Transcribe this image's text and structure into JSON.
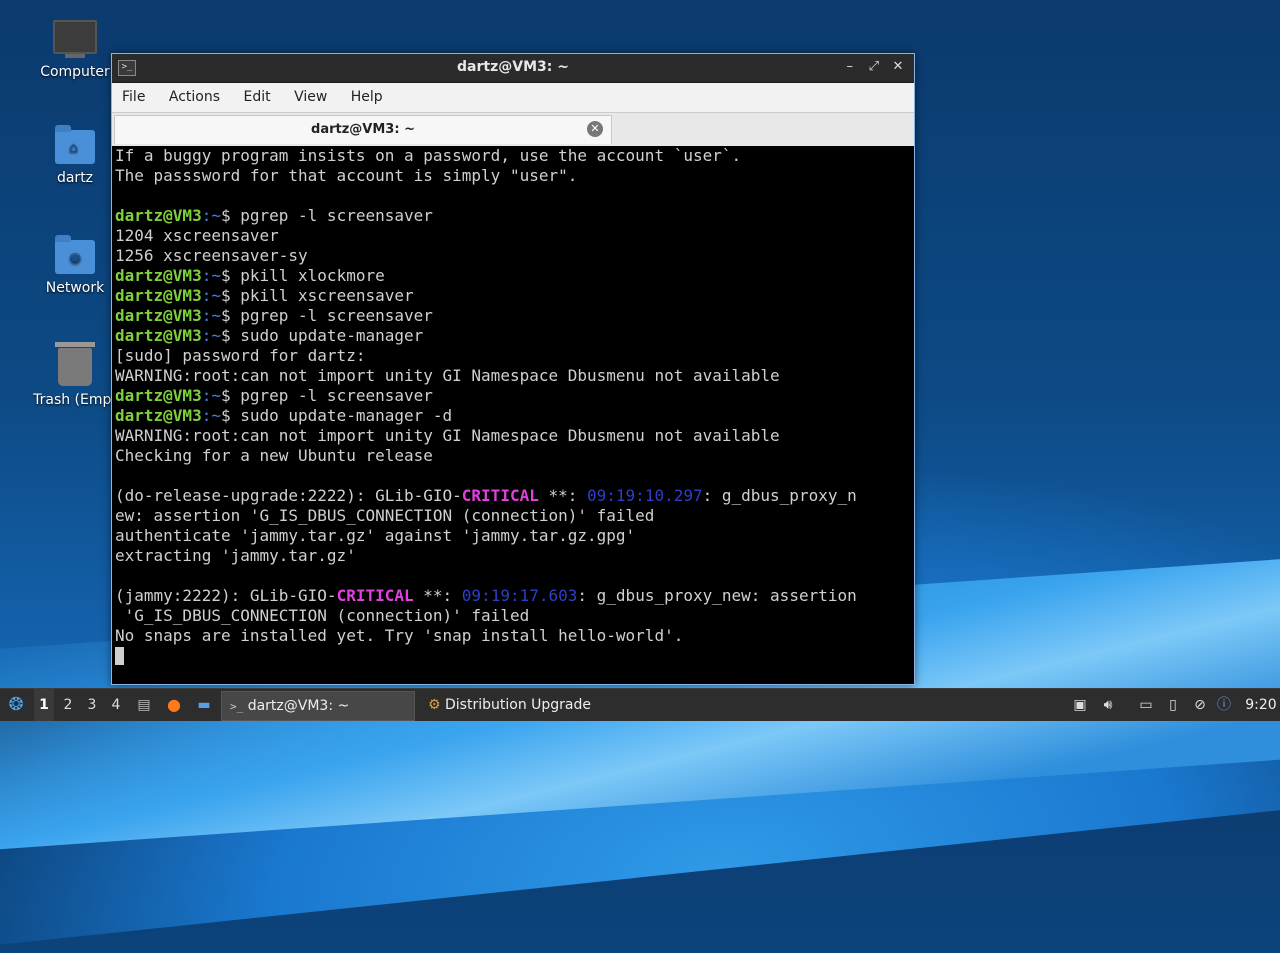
{
  "desktop": {
    "icons": [
      {
        "label": "Computer",
        "icon": "computer-icon"
      },
      {
        "label": "dartz",
        "icon": "home-folder-icon"
      },
      {
        "label": "Network",
        "icon": "network-folder-icon"
      },
      {
        "label": "Trash (Empt",
        "icon": "trash-icon"
      }
    ]
  },
  "window": {
    "title": "dartz@VM3: ~",
    "icon": ">_",
    "controls": {
      "minimize": "–",
      "maximize": "⤢",
      "close": "✕"
    },
    "menu": [
      "File",
      "Actions",
      "Edit",
      "View",
      "Help"
    ],
    "tab": {
      "label": "dartz@VM3: ~",
      "close": "✕"
    }
  },
  "terminal": {
    "prompt_user": "dartz@VM3",
    "prompt_path": ":~",
    "prompt_symbol": "$ ",
    "lines": [
      {
        "type": "text",
        "text": "If a buggy program insists on a password, use the account `user`."
      },
      {
        "type": "text",
        "text": "The passsword for that account is simply \"user\"."
      },
      {
        "type": "text",
        "text": ""
      },
      {
        "type": "cmd",
        "text": "pgrep -l screensaver"
      },
      {
        "type": "text",
        "text": "1204 xscreensaver"
      },
      {
        "type": "text",
        "text": "1256 xscreensaver-sy"
      },
      {
        "type": "cmd",
        "text": "pkill xlockmore"
      },
      {
        "type": "cmd",
        "text": "pkill xscreensaver"
      },
      {
        "type": "cmd",
        "text": "pgrep -l screensaver"
      },
      {
        "type": "cmd",
        "text": "sudo update-manager"
      },
      {
        "type": "text",
        "text": "[sudo] password for dartz:"
      },
      {
        "type": "text",
        "text": "WARNING:root:can not import unity GI Namespace Dbusmenu not available"
      },
      {
        "type": "cmd",
        "text": "pgrep -l screensaver"
      },
      {
        "type": "cmd",
        "text": "sudo update-manager -d"
      },
      {
        "type": "text",
        "text": "WARNING:root:can not import unity GI Namespace Dbusmenu not available"
      },
      {
        "type": "text",
        "text": "Checking for a new Ubuntu release"
      },
      {
        "type": "text",
        "text": ""
      },
      {
        "type": "crit",
        "pre": "(do-release-upgrade:2222): GLib-GIO-",
        "crit": "CRITICAL",
        "mid": " **: ",
        "ts": "09:19:10.297",
        "post": ": g_dbus_proxy_n"
      },
      {
        "type": "text",
        "text": "ew: assertion 'G_IS_DBUS_CONNECTION (connection)' failed"
      },
      {
        "type": "text",
        "text": "authenticate 'jammy.tar.gz' against 'jammy.tar.gz.gpg'"
      },
      {
        "type": "text",
        "text": "extracting 'jammy.tar.gz'"
      },
      {
        "type": "text",
        "text": ""
      },
      {
        "type": "crit",
        "pre": "(jammy:2222): GLib-GIO-",
        "crit": "CRITICAL",
        "mid": " **: ",
        "ts": "09:19:17.603",
        "post": ": g_dbus_proxy_new: assertion"
      },
      {
        "type": "text",
        "text": " 'G_IS_DBUS_CONNECTION (connection)' failed"
      },
      {
        "type": "text",
        "text": "No snaps are installed yet. Try 'snap install hello-world'."
      },
      {
        "type": "cursor",
        "text": ""
      }
    ]
  },
  "taskbar": {
    "workspaces": [
      "1",
      "2",
      "3",
      "4"
    ],
    "active_workspace": "1",
    "tasks": [
      {
        "label": "dartz@VM3: ~",
        "active": true
      },
      {
        "label": "Distribution Upgrade",
        "active": false
      }
    ],
    "clock": "9:20"
  },
  "colors": {
    "prompt_user": "#7fd13b",
    "prompt_path": "#4a7fe0",
    "critical": "#e040e0",
    "timestamp": "#2d3fc8"
  }
}
